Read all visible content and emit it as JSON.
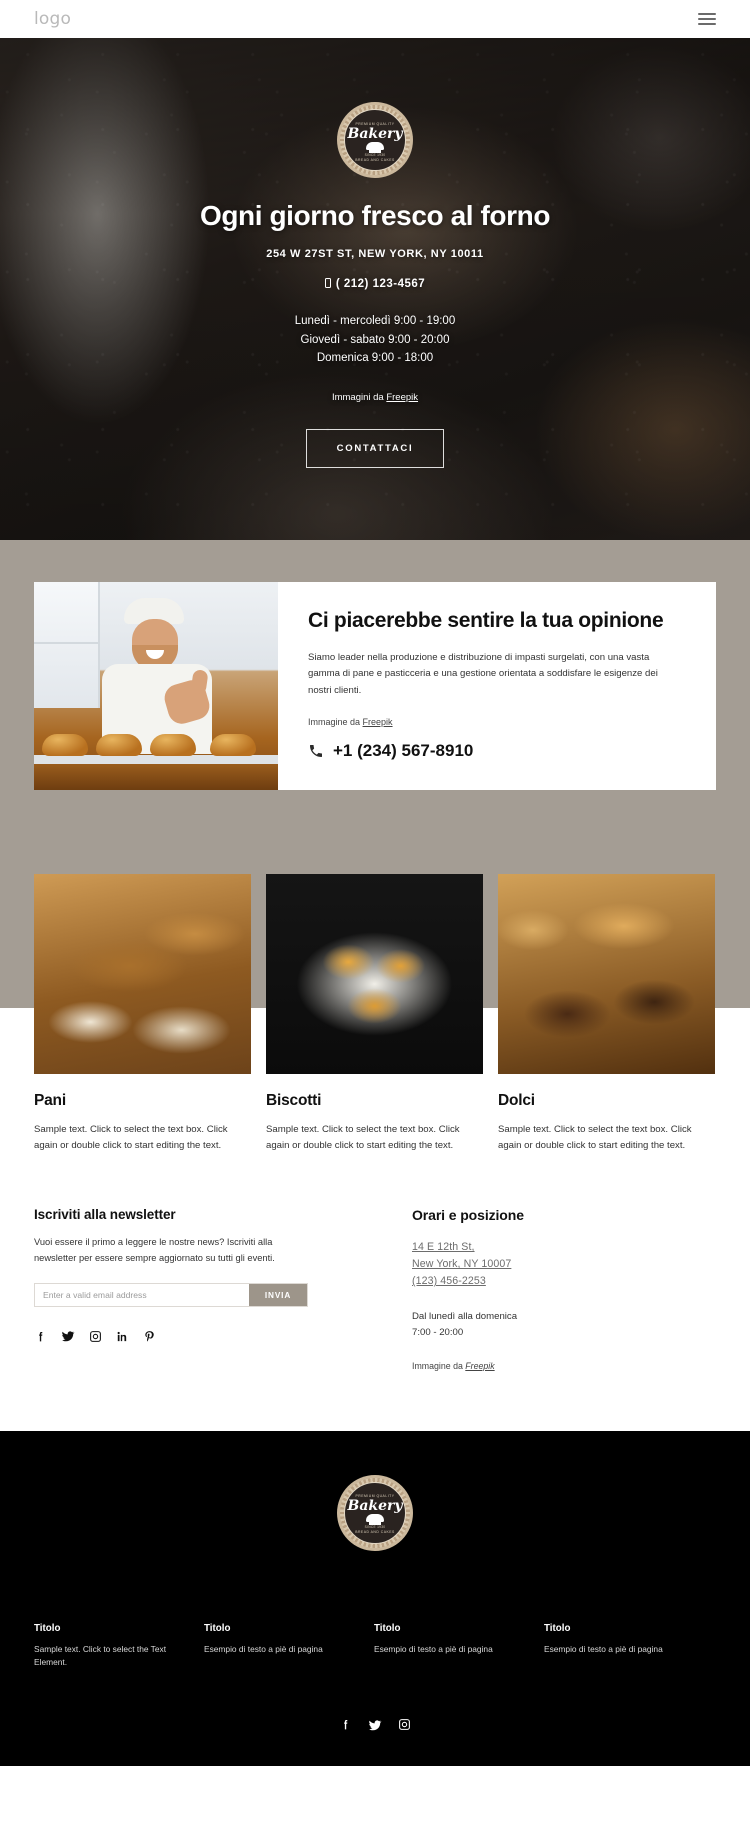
{
  "header": {
    "logo": "logo",
    "menu_icon": "hamburger-menu-icon"
  },
  "hero": {
    "badge": {
      "top_text": "PREMIUM QUALITY",
      "name": "Bakery",
      "since": "SINCE 1930",
      "bottom_text": "BREAD AND CAKES"
    },
    "title": "Ogni giorno fresco al forno",
    "address": "254 W 27ST ST, NEW YORK, NY 10011",
    "phone": "( 212) 123-4567",
    "hours": [
      "Lunedì - mercoledì 9:00 - 19:00",
      "Giovedì - sabato 9:00 - 20:00",
      "Domenica 9:00 - 18:00"
    ],
    "credit_prefix": "Immagini da ",
    "credit_link": "Freepik",
    "cta_label": "CONTATTACI"
  },
  "feature": {
    "title": "Ci piacerebbe sentire la tua opinione",
    "description": "Siamo leader nella produzione e distribuzione di impasti surgelati, con una vasta gamma di pane e pasticceria e una gestione orientata a soddisfare le esigenze dei nostri clienti.",
    "credit_prefix": "Immagine da ",
    "credit_link": "Freepik",
    "phone": "+1 (234) 567-8910",
    "phone_icon": "telephone-icon"
  },
  "products": [
    {
      "name": "Pani",
      "description": "Sample text. Click to select the text box. Click again or double click to start editing the text."
    },
    {
      "name": "Biscotti",
      "description": "Sample text. Click to select the text box. Click again or double click to start editing the text."
    },
    {
      "name": "Dolci",
      "description": "Sample text. Click to select the text box. Click again or double click to start editing the text."
    }
  ],
  "newsletter": {
    "title": "Iscriviti alla newsletter",
    "description": "Vuoi essere il primo a leggere le nostre news? Iscriviti alla newsletter per essere sempre aggiornato su tutti gli eventi.",
    "placeholder": "Enter a valid email address",
    "value": "",
    "submit_label": "INVIA",
    "socials": [
      "facebook-icon",
      "twitter-icon",
      "instagram-icon",
      "linkedin-icon",
      "pinterest-icon"
    ]
  },
  "location": {
    "title": "Orari e posizione",
    "address_line1": "14 E 12th St,",
    "address_line2": "New York, NY 10007",
    "phone": "(123) 456-2253",
    "hours_label": "Dal lunedì alla domenica",
    "hours_value": "7:00 - 20:00",
    "credit_prefix": "Immagine da ",
    "credit_link": "Freepik"
  },
  "footer": {
    "badge": {
      "top_text": "PREMIUM QUALITY",
      "name": "Bakery",
      "since": "SINCE 1930",
      "bottom_text": "BREAD AND CAKES"
    },
    "columns": [
      {
        "title": "Titolo",
        "text": "Sample text. Click to select the Text Element."
      },
      {
        "title": "Titolo",
        "text": "Esempio di testo a piè di pagina"
      },
      {
        "title": "Titolo",
        "text": "Esempio di testo a piè di pagina"
      },
      {
        "title": "Titolo",
        "text": "Esempio di testo a piè di pagina"
      }
    ],
    "socials": [
      "facebook-icon",
      "twitter-icon",
      "instagram-icon"
    ]
  },
  "colors": {
    "beige_band": "#a49d94",
    "submit_button": "#9d958a",
    "footer_bg": "#000000",
    "badge_ring": "#cbb89c"
  }
}
